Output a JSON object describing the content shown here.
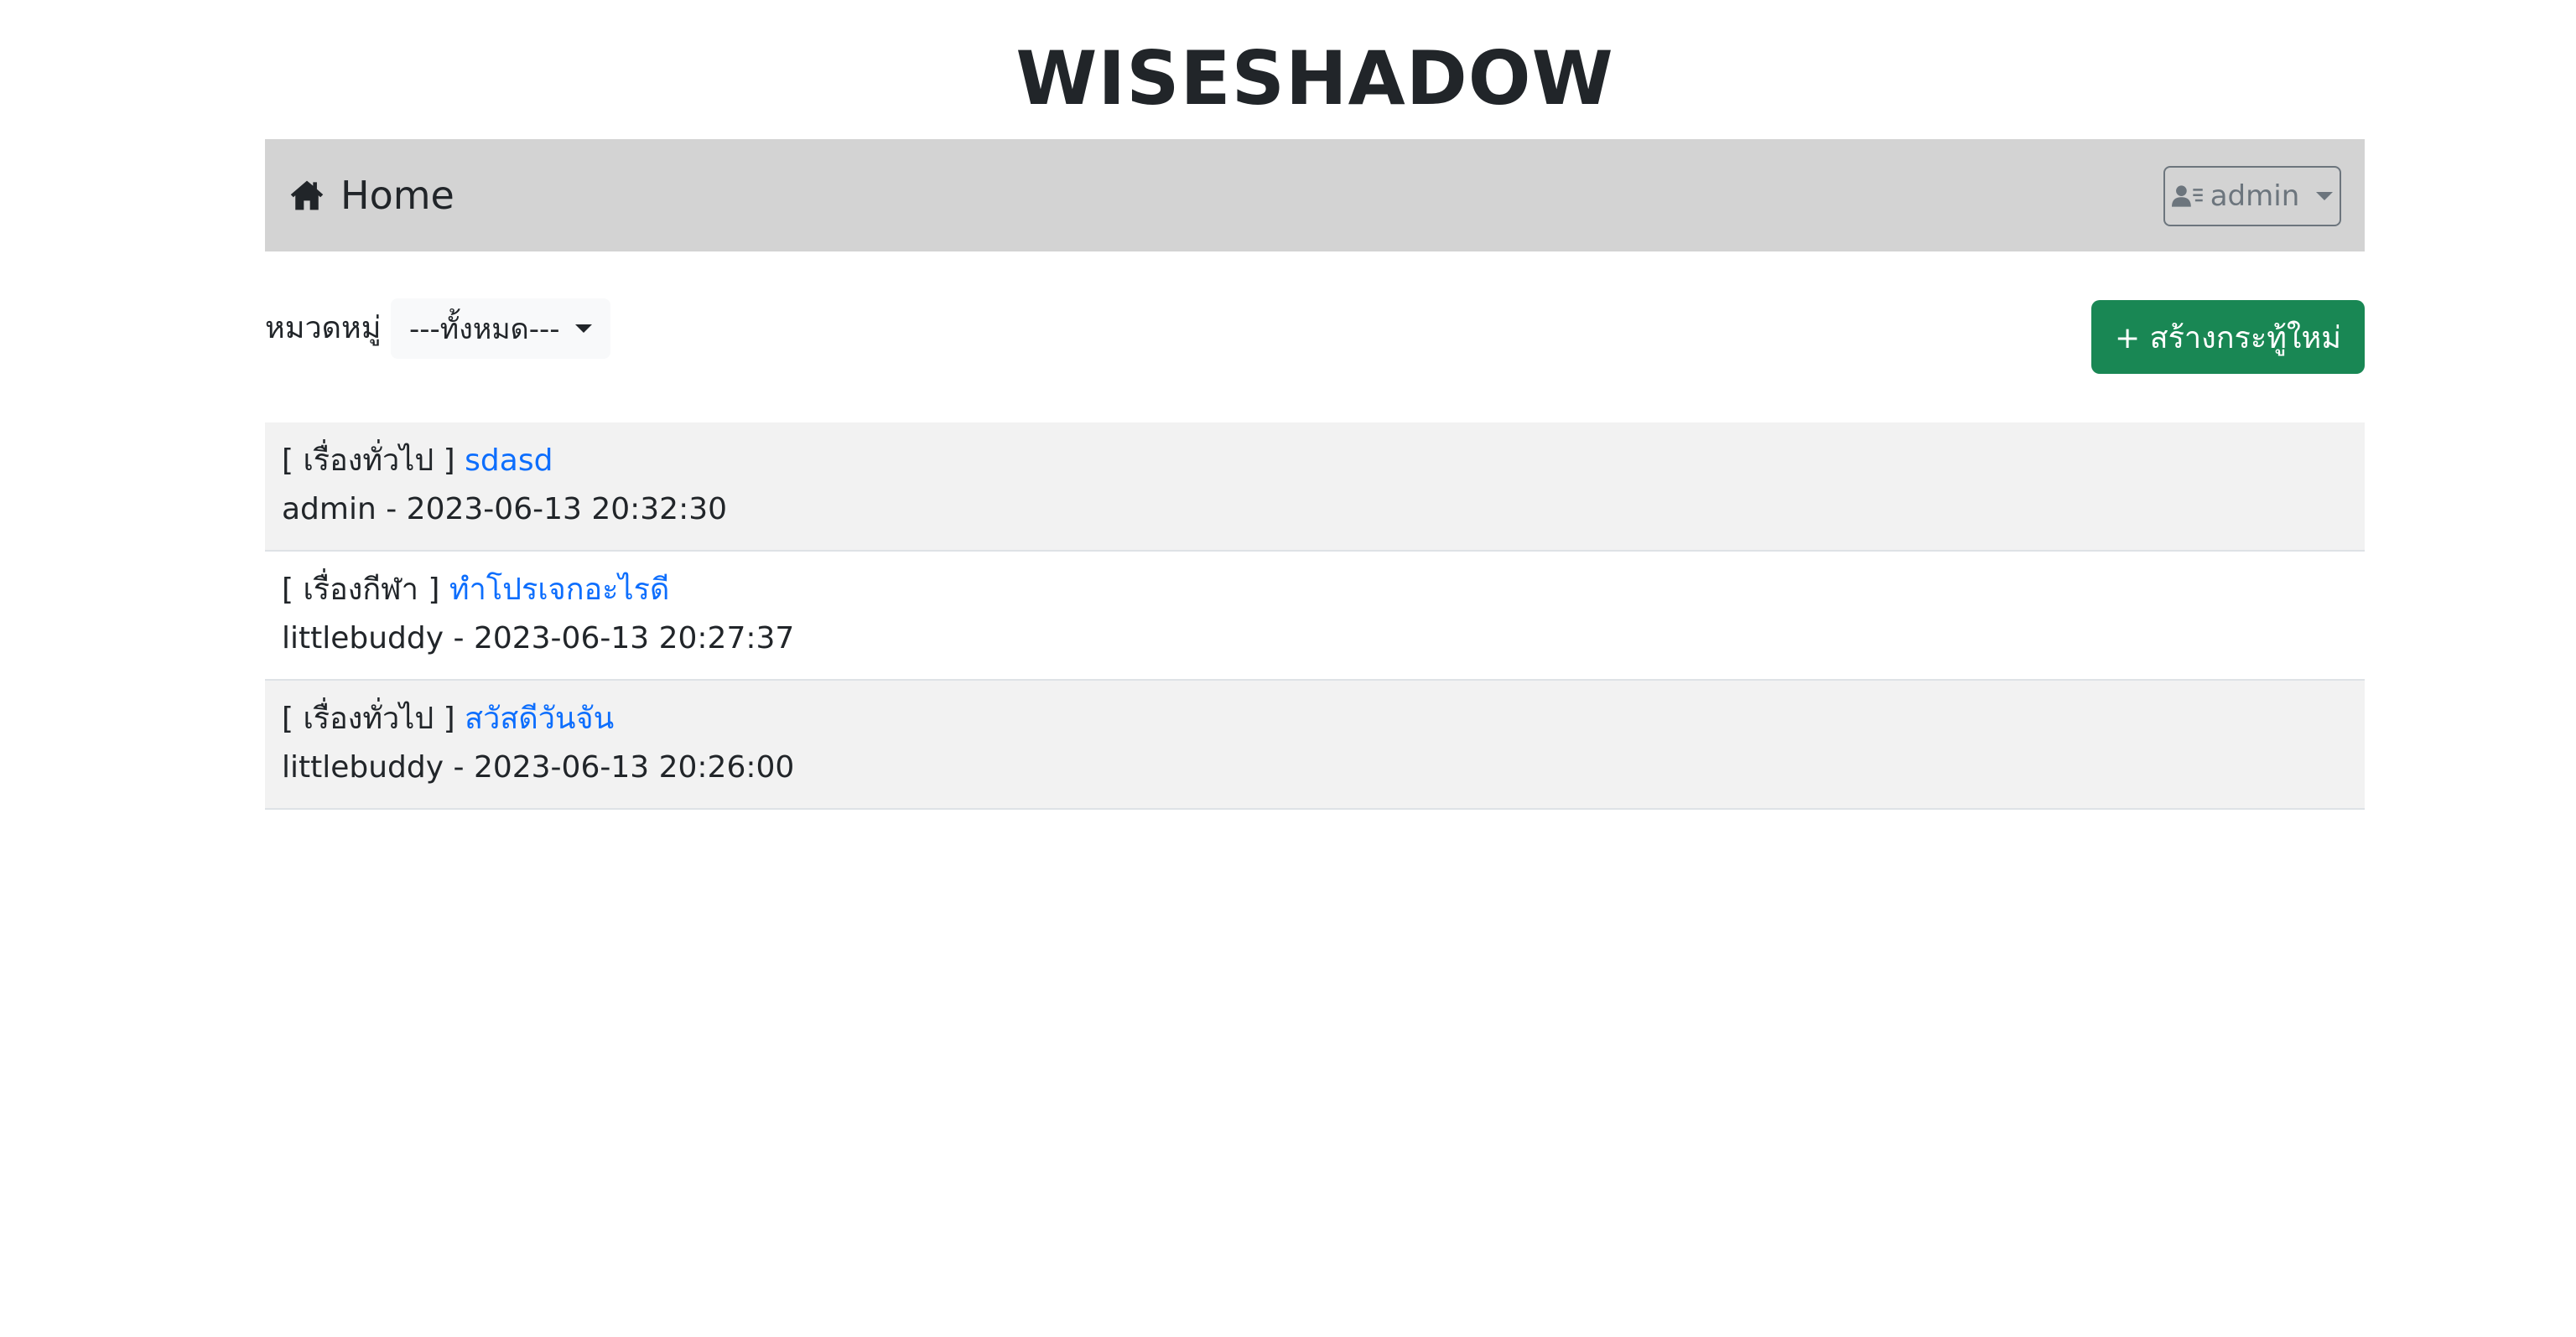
{
  "site": {
    "title": "WISESHADOW"
  },
  "navbar": {
    "home_label": "Home",
    "user_label": "admin",
    "home_icon": "house-icon",
    "user_icon": "user-list-icon"
  },
  "filter": {
    "label": "หมวดหมู่",
    "selected": "---ทั้งหมด---"
  },
  "actions": {
    "create_label": "+ สร้างกระทู้ใหม่"
  },
  "posts": [
    {
      "category": "[ เรื่องทั่วไป ]",
      "title": "sdasd",
      "meta": "admin - 2023-06-13 20:32:30"
    },
    {
      "category": "[ เรื่องกีฬา ]",
      "title": "ทำโปรเจกอะไรดี",
      "meta": "littlebuddy - 2023-06-13 20:27:37"
    },
    {
      "category": "[ เรื่องทั่วไป ]",
      "title": "สวัสดีวันจัน",
      "meta": "littlebuddy - 2023-06-13 20:26:00"
    }
  ],
  "colors": {
    "navbar_bg": "#d3d3d3",
    "create_button": "#198754",
    "link": "#0d6efd",
    "row_alt": "#f2f2f2"
  }
}
